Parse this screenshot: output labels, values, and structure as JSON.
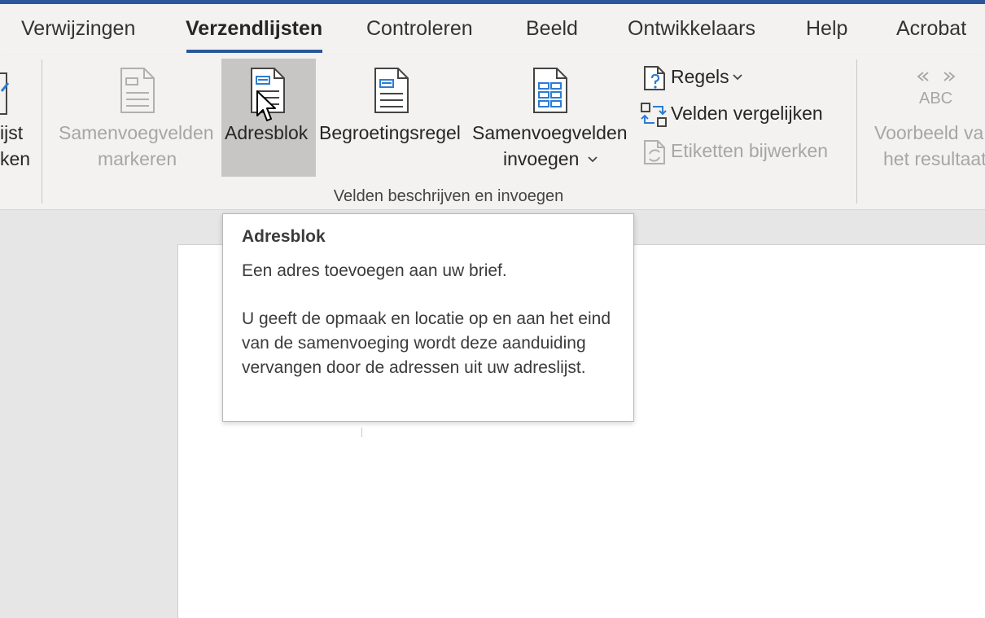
{
  "ribbon_tabs": {
    "verwijzingen": "Verwijzingen",
    "verzendlijsten": "Verzendlijsten",
    "controleren": "Controleren",
    "beeld": "Beeld",
    "ontwikkelaars": "Ontwikkelaars",
    "help": "Help",
    "acrobat": "Acrobat"
  },
  "left_cut_button": {
    "line1": "ijst",
    "line2": "ken"
  },
  "group": {
    "label": "Velden beschrijven en invoegen",
    "samenvoegvelden_markeren": {
      "line1": "Samenvoegvelden",
      "line2": "markeren"
    },
    "adresblok": "Adresblok",
    "begroetingsregel": "Begroetingsregel",
    "samenvoegvelden_invoegen": {
      "line1": "Samenvoegvelden",
      "line2": "invoegen"
    },
    "regels": "Regels",
    "velden_vergelijken": "Velden vergelijken",
    "etiketten_bijwerken": "Etiketten bijwerken"
  },
  "preview_group": {
    "abc": "ABC",
    "line1": "Voorbeeld va",
    "line2": "het resultaat"
  },
  "tooltip": {
    "title": "Adresblok",
    "line1": "Een adres toevoegen aan uw brief.",
    "description": "U geeft de opmaak en locatie op en aan het eind van de samenvoeging wordt deze aanduiding vervangen door de adressen uit uw adreslijst."
  },
  "colors": {
    "accent": "#2b579a",
    "icon_blue": "#2b7cd3",
    "disabled": "#a6a6a6"
  }
}
